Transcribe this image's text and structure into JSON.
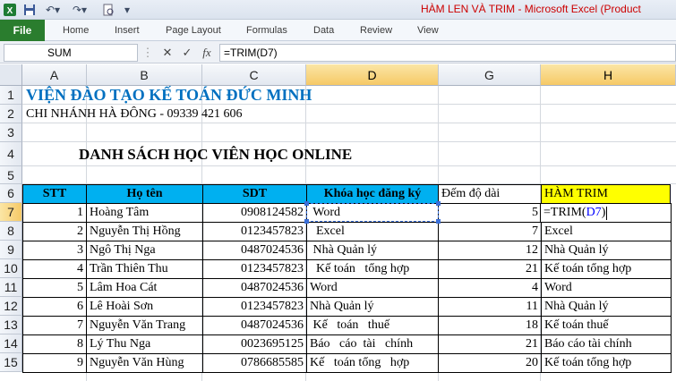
{
  "window": {
    "title": "HÀM LEN VÀ TRIM  -  Microsoft Excel (Product",
    "qat_icons": [
      "excel-logo-icon",
      "save-icon",
      "undo-icon",
      "redo-icon",
      "print-preview-icon",
      "customize-qat-icon"
    ]
  },
  "ribbon": {
    "file": "File",
    "tabs": [
      "Home",
      "Insert",
      "Page Layout",
      "Formulas",
      "Data",
      "Review",
      "View"
    ]
  },
  "formula_bar": {
    "name_box": "SUM",
    "cancel": "✕",
    "enter": "✓",
    "fx": "fx",
    "formula": "=TRIM(D7)"
  },
  "columns": [
    "A",
    "B",
    "C",
    "D",
    "G",
    "H"
  ],
  "rows": [
    "1",
    "2",
    "3",
    "4",
    "5",
    "6",
    "7",
    "8",
    "9",
    "10",
    "11",
    "12",
    "13",
    "14",
    "15"
  ],
  "sheet": {
    "title1": "VIỆN ĐÀO TẠO KẾ TOÁN ĐỨC MINH",
    "title2": "CHI NHÁNH HÀ ĐÔNG - 09339 421 606",
    "heading": "DANH SÁCH HỌC VIÊN HỌC ONLINE",
    "headers": {
      "stt": "STT",
      "name": "Họ tên",
      "phone": "SDT",
      "course": "Khóa học đăng ký",
      "count": "Đếm độ dài",
      "trim": "HÀM TRIM"
    },
    "edit_prefix": "=TRIM(",
    "edit_ref": "D7",
    "edit_suffix": ")",
    "data": [
      {
        "stt": "1",
        "name": "Hoàng Tâm",
        "phone": "0908124582",
        "course": " Word",
        "count": "5",
        "trim": ""
      },
      {
        "stt": "2",
        "name": "Nguyễn Thị Hồng",
        "phone": "0123457823",
        "course": "  Excel",
        "count": "7",
        "trim": "Excel"
      },
      {
        "stt": "3",
        "name": "Ngô Thị Nga",
        "phone": "0487024536",
        "course": " Nhà Quản lý",
        "count": "12",
        "trim": "Nhà Quản lý"
      },
      {
        "stt": "4",
        "name": "Trần Thiên Thu",
        "phone": "0123457823",
        "course": "  Kế toán   tổng hợp",
        "count": "21",
        "trim": "Kế toán tổng hợp"
      },
      {
        "stt": "5",
        "name": "Lâm Hoa Cát",
        "phone": "0487024536",
        "course": "Word",
        "count": "4",
        "trim": "Word"
      },
      {
        "stt": "6",
        "name": "Lê Hoài Sơn",
        "phone": "0123457823",
        "course": "Nhà Quản lý",
        "count": "11",
        "trim": "Nhà Quản lý"
      },
      {
        "stt": "7",
        "name": "Nguyễn Văn Trang",
        "phone": "0487024536",
        "course": " Kế   toán   thuế",
        "count": "18",
        "trim": "Kế toán thuế"
      },
      {
        "stt": "8",
        "name": "Lý Thu Nga",
        "phone": "0023695125",
        "course": "Báo   cáo  tài   chính",
        "count": "21",
        "trim": "Báo cáo tài chính"
      },
      {
        "stt": "9",
        "name": "Nguyễn Văn Hùng",
        "phone": "0786685585",
        "course": "Kế   toán tổng   hợp",
        "count": "20",
        "trim": "Kế toán tổng hợp"
      }
    ]
  },
  "colors": {
    "header_blue": "#00b0f0",
    "header_yellow": "#ffff00",
    "title_blue": "#0070c0",
    "ref_blue": "#0000ff",
    "file_green": "#2a7d2e",
    "title_red": "#cc0000"
  }
}
